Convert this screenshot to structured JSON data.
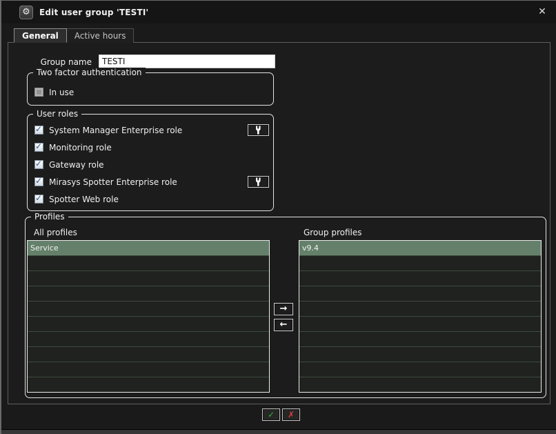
{
  "window": {
    "title": "Edit user group 'TESTI'"
  },
  "icons": {
    "gear": "⚙",
    "close": "✕",
    "ok_check": "✓",
    "cancel_cross": "✗",
    "move_right": "→",
    "move_left": "←"
  },
  "tabs": [
    {
      "label": "General",
      "active": true
    },
    {
      "label": "Active hours",
      "active": false
    }
  ],
  "general": {
    "group_name": {
      "label": "Group name",
      "value": "TESTI"
    },
    "two_factor": {
      "legend": "Two factor authentication",
      "checkbox_label": "In use",
      "checked": false
    },
    "user_roles": {
      "legend": "User roles",
      "roles": [
        {
          "label": "System Manager Enterprise role",
          "checked": true,
          "has_settings_button": true
        },
        {
          "label": "Monitoring role",
          "checked": true,
          "has_settings_button": false
        },
        {
          "label": "Gateway role",
          "checked": true,
          "has_settings_button": false
        },
        {
          "label": "Mirasys Spotter Enterprise role",
          "checked": true,
          "has_settings_button": true
        },
        {
          "label": "Spotter Web role",
          "checked": true,
          "has_settings_button": false
        }
      ]
    },
    "profiles": {
      "legend": "Profiles",
      "all_profiles_label": "All profiles",
      "group_profiles_label": "Group profiles",
      "all_profiles": [
        {
          "name": "Service",
          "selected": true
        }
      ],
      "group_profiles": [
        {
          "name": "v9.4",
          "selected": true
        }
      ],
      "visible_rows": 10
    }
  },
  "colors": {
    "selected_row": "#64806a",
    "ok_green": "#35b535",
    "cancel_red": "#e23c3c",
    "panel_bg": "#1c1c1c"
  }
}
